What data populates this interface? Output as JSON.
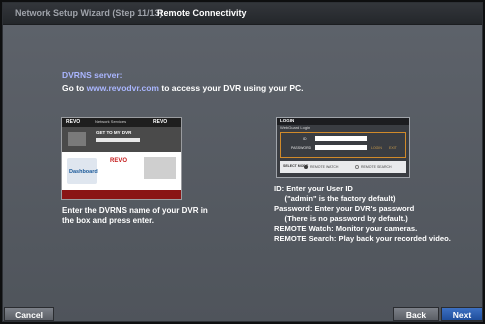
{
  "titlebar": {
    "step": "Network Setup Wizard (Step 11/13)",
    "name": "Remote Connectivity"
  },
  "dvrns": {
    "heading": "DVRNS server:",
    "line_prefix": "Go to ",
    "link": "www.revodvr.com",
    "line_suffix": " to access your DVR using your PC."
  },
  "website_thumb": {
    "logo_left": "REVO",
    "logo_right": "REVO",
    "nav_text": "Network Services",
    "hero_title": "GET TO MY DVR",
    "dashboard_label": "Dashboard",
    "brand_text": "REVO"
  },
  "instructions_left": {
    "line1": "Enter the DVRNS name of your DVR in",
    "line2": " the box and press enter."
  },
  "login_thumb": {
    "bar_title": "LOGIN",
    "subtitle": "WebGuard Login",
    "id_label": "ID",
    "password_label": "PASSWORD",
    "mini_a": "LOGIN",
    "mini_b": "EXIT",
    "option_label": "SELECT MODE",
    "watch_label": "REMOTE WATCH",
    "search_label": "REMOTE SEARCH"
  },
  "instructions_right": {
    "l1": "ID: Enter your User ID",
    "l2": "     (\"admin\" is the factory default)",
    "l3": "Password: Enter your DVR's password",
    "l4": "     (There is no password by default.)",
    "l5": "REMOTE Watch: Monitor your cameras.",
    "l6": "REMOTE Search: Play back your recorded video."
  },
  "buttons": {
    "cancel": "Cancel",
    "back": "Back",
    "next": "Next"
  },
  "colors": {
    "link": "#aab6ff",
    "next_button": "#2a5cae"
  }
}
